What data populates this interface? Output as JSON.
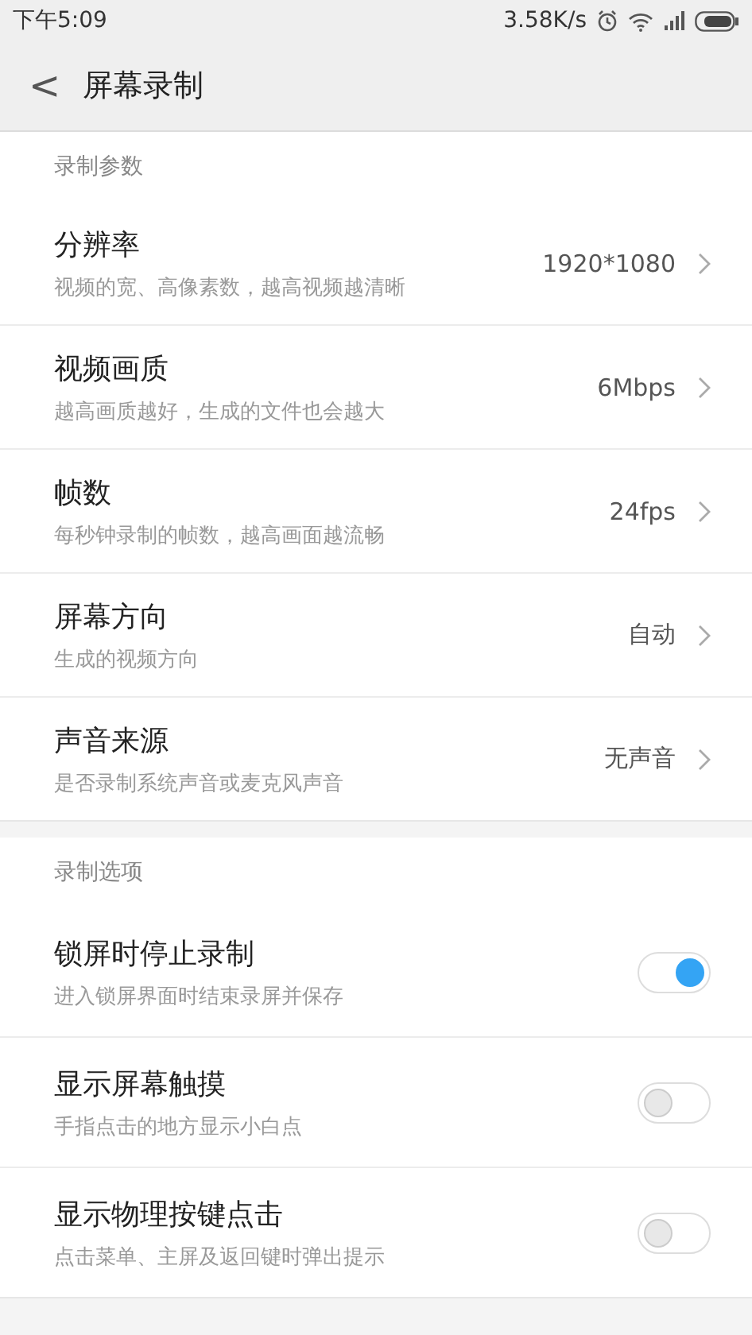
{
  "status_bar": {
    "time": "下午5:09",
    "speed": "3.58K/s"
  },
  "header": {
    "back": "<",
    "title": "屏幕录制"
  },
  "sections": [
    {
      "title": "录制参数",
      "items": [
        {
          "kind": "value",
          "title": "分辨率",
          "subtitle": "视频的宽、高像素数，越高视频越清晰",
          "value": "1920*1080"
        },
        {
          "kind": "value",
          "title": "视频画质",
          "subtitle": "越高画质越好，生成的文件也会越大",
          "value": "6Mbps"
        },
        {
          "kind": "value",
          "title": "帧数",
          "subtitle": "每秒钟录制的帧数，越高画面越流畅",
          "value": "24fps"
        },
        {
          "kind": "value",
          "title": "屏幕方向",
          "subtitle": "生成的视频方向",
          "value": "自动"
        },
        {
          "kind": "value",
          "title": "声音来源",
          "subtitle": "是否录制系统声音或麦克风声音",
          "value": "无声音"
        }
      ]
    },
    {
      "title": "录制选项",
      "items": [
        {
          "kind": "toggle",
          "title": "锁屏时停止录制",
          "subtitle": "进入锁屏界面时结束录屏并保存",
          "on": true
        },
        {
          "kind": "toggle",
          "title": "显示屏幕触摸",
          "subtitle": "手指点击的地方显示小白点",
          "on": false
        },
        {
          "kind": "toggle",
          "title": "显示物理按键点击",
          "subtitle": "点击菜单、主屏及返回键时弹出提示",
          "on": false
        }
      ]
    }
  ]
}
